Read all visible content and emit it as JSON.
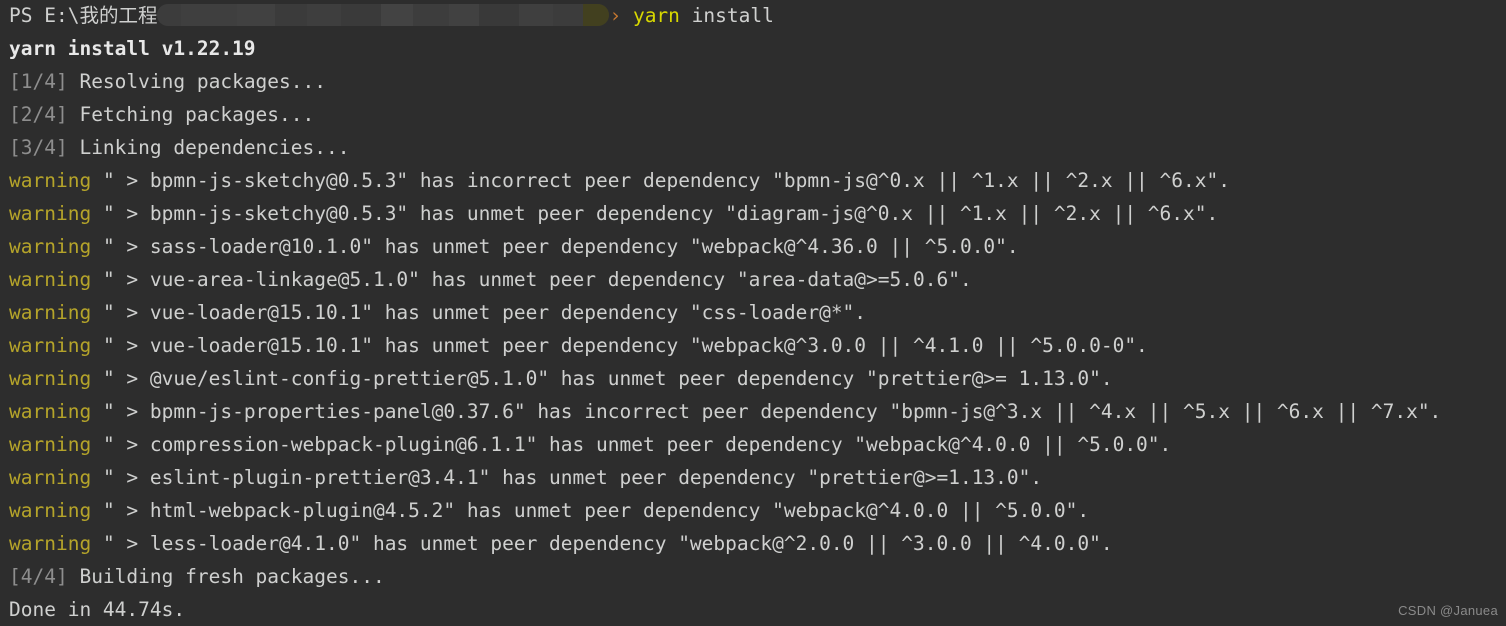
{
  "terminal": {
    "background_color": "#2d2d2d",
    "default_text_color": "#cfd0cf",
    "warning_color": "#b5a42a",
    "yarn_color": "#d8d800",
    "dim_color": "#8e8e8e",
    "prompt": {
      "prefix": "PS E:\\我的工程",
      "redacted_path": "",
      "arrow": "›",
      "command_name": "yarn",
      "command_args": "install"
    },
    "header_line": "yarn install v1.22.19",
    "steps": [
      {
        "marker": "[1/4]",
        "text": "Resolving packages..."
      },
      {
        "marker": "[2/4]",
        "text": "Fetching packages..."
      },
      {
        "marker": "[3/4]",
        "text": "Linking dependencies..."
      }
    ],
    "warning_label": "warning",
    "warnings": [
      {
        "body": "\" > bpmn-js-sketchy@0.5.3\" has incorrect peer dependency \"bpmn-js@^0.x || ^1.x || ^2.x || ^6.x\"."
      },
      {
        "body": "\" > bpmn-js-sketchy@0.5.3\" has unmet peer dependency \"diagram-js@^0.x || ^1.x || ^2.x || ^6.x\"."
      },
      {
        "body": "\" > sass-loader@10.1.0\" has unmet peer dependency \"webpack@^4.36.0 || ^5.0.0\"."
      },
      {
        "body": "\" > vue-area-linkage@5.1.0\" has unmet peer dependency \"area-data@>=5.0.6\"."
      },
      {
        "body": "\" > vue-loader@15.10.1\" has unmet peer dependency \"css-loader@*\"."
      },
      {
        "body": "\" > vue-loader@15.10.1\" has unmet peer dependency \"webpack@^3.0.0 || ^4.1.0 || ^5.0.0-0\"."
      },
      {
        "body": "\" > @vue/eslint-config-prettier@5.1.0\" has unmet peer dependency \"prettier@>= 1.13.0\"."
      },
      {
        "body": "\" > bpmn-js-properties-panel@0.37.6\" has incorrect peer dependency \"bpmn-js@^3.x || ^4.x || ^5.x || ^6.x || ^7.x\"."
      },
      {
        "body": "\" > compression-webpack-plugin@6.1.1\" has unmet peer dependency \"webpack@^4.0.0 || ^5.0.0\"."
      },
      {
        "body": "\" > eslint-plugin-prettier@3.4.1\" has unmet peer dependency \"prettier@>=1.13.0\"."
      },
      {
        "body": "\" > html-webpack-plugin@4.5.2\" has unmet peer dependency \"webpack@^4.0.0 || ^5.0.0\"."
      },
      {
        "body": "\" > less-loader@4.1.0\" has unmet peer dependency \"webpack@^2.0.0 || ^3.0.0 || ^4.0.0\"."
      }
    ],
    "final_step": {
      "marker": "[4/4]",
      "text": "Building fresh packages..."
    },
    "done_line": "Done in 44.74s."
  },
  "watermark": "CSDN @Januea"
}
